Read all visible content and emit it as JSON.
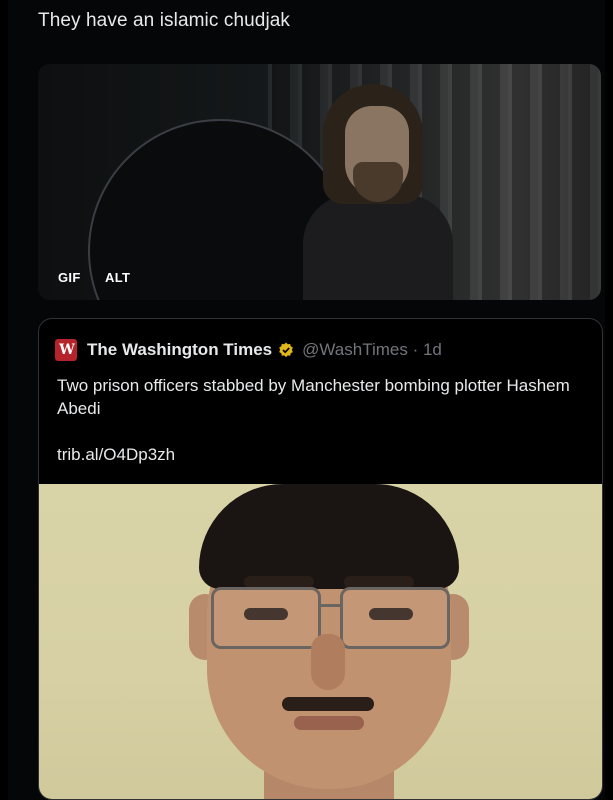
{
  "tweet": {
    "text": "They have an islamic chudjak",
    "media": {
      "gif_label": "GIF",
      "alt_label": "ALT"
    }
  },
  "quote": {
    "author": "The Washington Times",
    "logo_glyph": "W",
    "verified_icon": "verified-badge-icon",
    "verified_color": "#e2b719",
    "handle": "@WashTimes · 1d",
    "body": "Two prison officers stabbed by Manchester bombing plotter Hashem Abedi",
    "link": "trib.al/O4Dp3zh"
  },
  "colors": {
    "background": "#000000",
    "text": "#e7e9ea",
    "muted": "#71767b",
    "logo": "#b4242a"
  }
}
